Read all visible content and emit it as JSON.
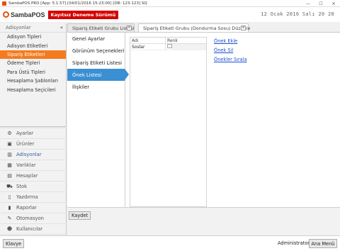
{
  "window": {
    "title": "SambaPOS PRO [App: 5.1.57] [04/01/2016 15:23:00] [DB: 123-123] SQ",
    "controls": [
      "—",
      "☐",
      "✕"
    ]
  },
  "header": {
    "logo_text": "SambaPOS",
    "trial_badge": "Kayıtsız Deneme Sürümü",
    "clock": "12 Ocak 2016 Salı 20 20"
  },
  "sidebar": {
    "section_title": "Adisyonlar",
    "collapse_glyph": "«",
    "items": [
      {
        "label": "Adisyon Tipleri"
      },
      {
        "label": "Adisyon Etiketleri"
      },
      {
        "label": "Sipariş Etiketleri"
      },
      {
        "label": "Ödeme Tipleri"
      },
      {
        "label": "Para Üstü Tipleri"
      },
      {
        "label": "Hesaplama Şablonları"
      },
      {
        "label": "Hesaplama Seçicileri"
      }
    ],
    "active_index": 2,
    "nav": [
      {
        "label": "Ayarlar",
        "icon": "gear-icon",
        "glyph": "⚙"
      },
      {
        "label": "Ürünler",
        "icon": "cube-icon",
        "glyph": "▣"
      },
      {
        "label": "Adisyonlar",
        "icon": "books-icon",
        "glyph": "▥"
      },
      {
        "label": "Varlıklar",
        "icon": "table-icon",
        "glyph": "▦"
      },
      {
        "label": "Hesaplar",
        "icon": "calculator-icon",
        "glyph": "▤"
      },
      {
        "label": "Stok",
        "icon": "truck-icon",
        "glyph": "⛟"
      },
      {
        "label": "Yazdırma",
        "icon": "document-icon",
        "glyph": "▯"
      },
      {
        "label": "Raporlar",
        "icon": "bar-chart-icon",
        "glyph": "▮"
      },
      {
        "label": "Otomasyon",
        "icon": "wrench-icon",
        "glyph": "✎"
      },
      {
        "label": "Kullanıcılar",
        "icon": "user-icon",
        "glyph": "☻"
      }
    ],
    "selected_nav_index": 2
  },
  "tabs": [
    {
      "label": "Sipariş Etiketi Grubu Listesi",
      "close": "×"
    },
    {
      "label": "Sipariş Etiketi Grubu (Dondurma Sosu) Düzenle",
      "close": "×"
    }
  ],
  "editor": {
    "subnav": [
      {
        "label": "Genel Ayarlar"
      },
      {
        "label": "Görünüm Seçenekleri"
      },
      {
        "label": "Sipariş Etiketi Listesi"
      },
      {
        "label": "Önek Listesi"
      },
      {
        "label": "İlişkiler"
      }
    ],
    "active_subnav_index": 3,
    "grid": {
      "columns": [
        "Adı",
        "Renk"
      ],
      "rows": [
        {
          "name": "Soslar",
          "color": ""
        }
      ]
    },
    "actions": [
      "Önek Ekle",
      "Önek Sil",
      "Önekler Sırala"
    ],
    "save_label": "Kaydet"
  },
  "footer": {
    "keyboard_label": "Klavye",
    "user_label": "Administrator",
    "main_menu_label": "Ana Menü"
  }
}
